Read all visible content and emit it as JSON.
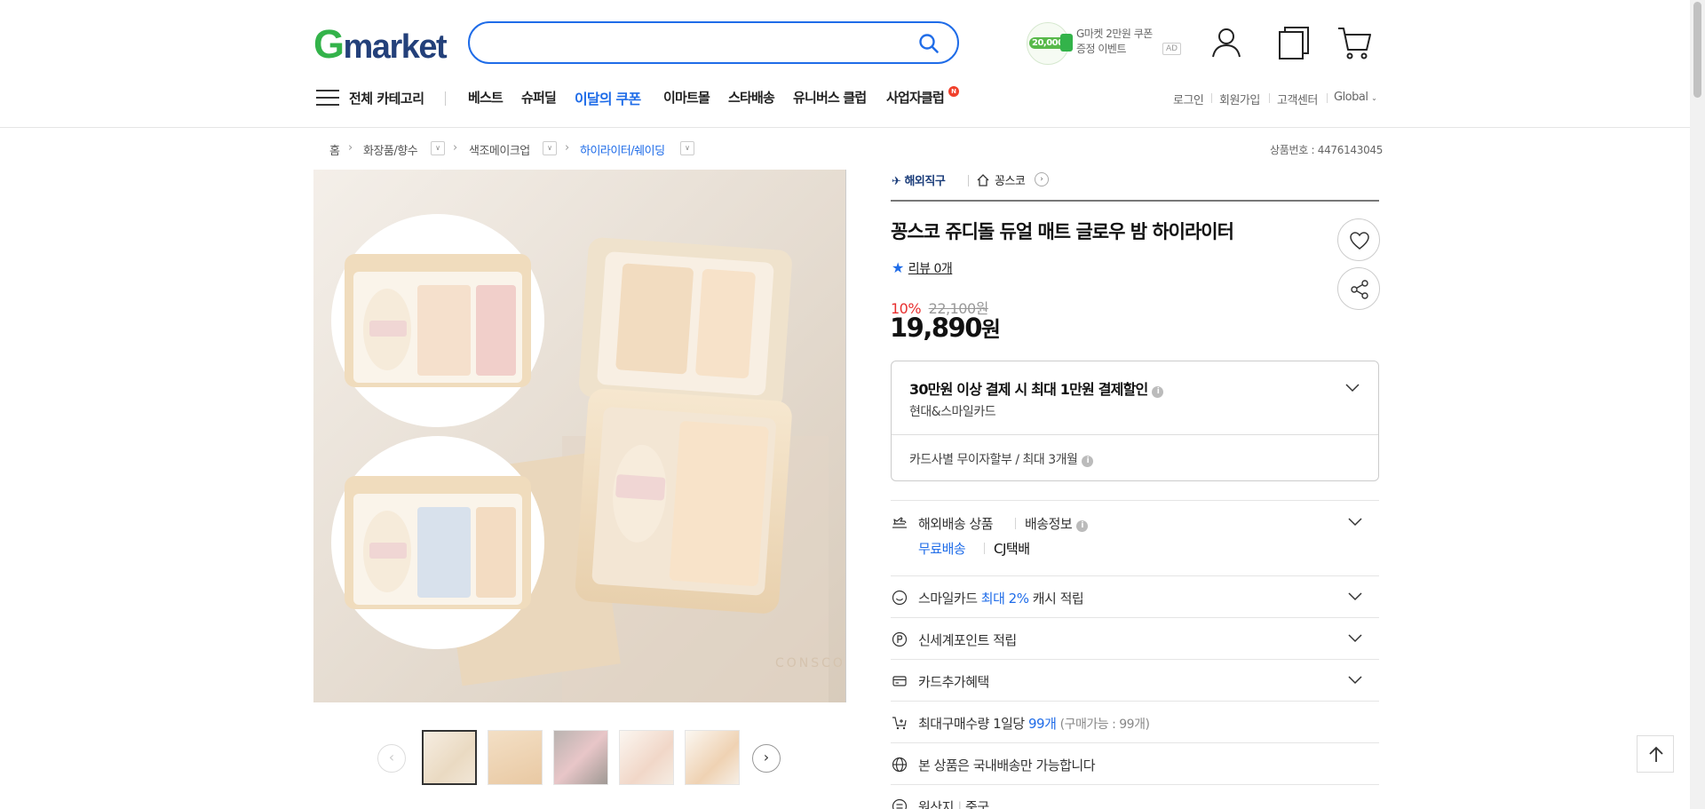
{
  "header": {
    "logo_g": "G",
    "logo_rest": "market",
    "search": {
      "value": "",
      "placeholder": ""
    },
    "promo": {
      "amount": "20,000",
      "line1": "G마켓 2만원 쿠폰",
      "line2": "증정 이벤트",
      "ad": "AD"
    }
  },
  "nav": {
    "all_categories": "전체 카테고리",
    "items": [
      "베스트",
      "슈퍼딜",
      "이달의 쿠폰",
      "이마트몰",
      "스타배송",
      "유니버스 클럽",
      "사업자클럽"
    ],
    "new_badge": "N",
    "util": [
      "로그인",
      "회원가입",
      "고객센터",
      "Global"
    ]
  },
  "breadcrumb": {
    "items": [
      "홈",
      "화장품/향수",
      "색조메이크업",
      "하이라이터/쉐이딩"
    ],
    "product_no_label": "상품번호 : 4476143045"
  },
  "product": {
    "badge_overseas": "해외직구",
    "seller": "꽁스코",
    "title": "꽁스코 쥬디돌 듀얼 매트 글로우 밤 하이라이터",
    "review_label": "리뷰 0개",
    "discount_rate": "10%",
    "original_price": "22,100원",
    "price": "19,890",
    "price_unit": "원",
    "card_offer": {
      "title": "30만원 이상 결제 시 최대 1만원 결제할인",
      "subtitle": "현대&스마일카드",
      "installment": "카드사별 무이자할부 / 최대 3개월"
    },
    "shipping": {
      "label": "해외배송 상품",
      "info_label": "배송정보",
      "free": "무료배송",
      "carrier": "CJ택배"
    },
    "rows": {
      "smilecard_pre": "스마일카드",
      "smilecard_hl": "최대 2%",
      "smilecard_post": "캐시 적립",
      "shinsegae": "신세계포인트 적립",
      "card_benefit": "카드추가혜택",
      "max_qty_pre": "최대구매수량 1일당",
      "max_qty_hl": "99개",
      "max_qty_post": "(구매가능 : 99개)",
      "domestic_only": "본 상품은 국내배송만 가능합니다",
      "origin_label": "원산지",
      "origin_value": "중국"
    }
  },
  "gallery": {
    "thumbnails": [
      "thumb-1",
      "thumb-2",
      "thumb-3",
      "thumb-4",
      "thumb-5"
    ],
    "active_index": 0,
    "watermark": "CONSCO"
  },
  "colors": {
    "brand_green": "#33b34a",
    "brand_navy": "#23407a",
    "accent_blue": "#1f6ce8",
    "discount_red": "#e82e2e"
  }
}
